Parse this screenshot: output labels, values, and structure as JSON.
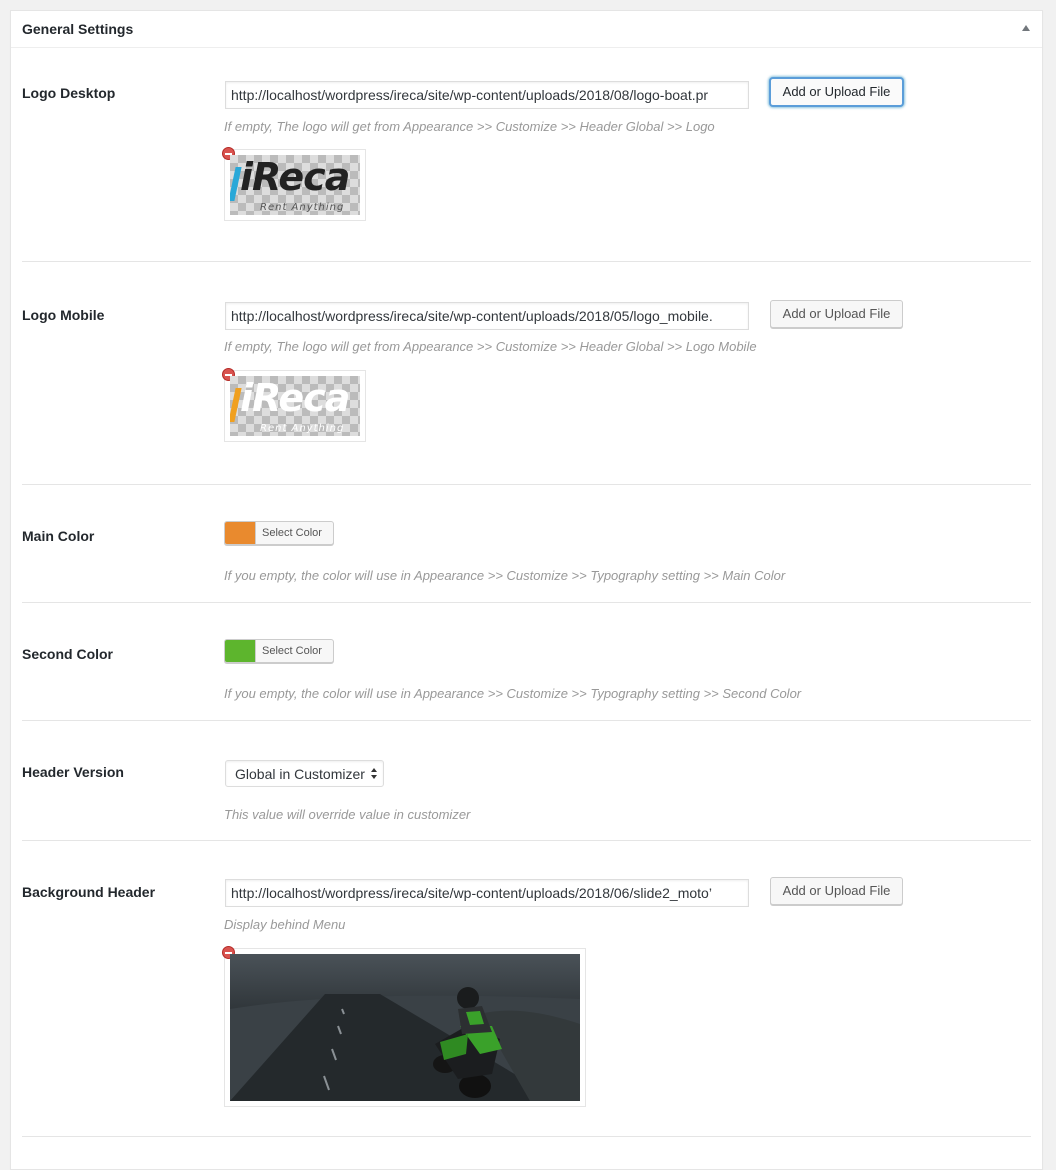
{
  "panel": {
    "title": "General Settings"
  },
  "logo_desktop": {
    "label": "Logo Desktop",
    "url": "http://localhost/wordpress/ireca/site/wp-content/uploads/2018/08/logo-boat.pr",
    "button": "Add or Upload File",
    "description": "If empty, The logo will get from Appearance >> Customize >> Header Global >> Logo",
    "logo_text": "iReca",
    "logo_sub": "Rent Anything",
    "colors": {
      "bar": "#2aa8d8",
      "word": "#222222",
      "sub": "#555555"
    }
  },
  "logo_mobile": {
    "label": "Logo Mobile",
    "url": "http://localhost/wordpress/ireca/site/wp-content/uploads/2018/05/logo_mobile.",
    "button": "Add or Upload File",
    "description": "If empty, The logo will get from Appearance >> Customize >> Header Global >> Logo Mobile",
    "logo_text": "iReca",
    "logo_sub": "Rent Anything",
    "colors": {
      "bar": "#f0a020",
      "word": "#ffffff",
      "sub": "#ffffff"
    }
  },
  "main_color": {
    "label": "Main Color",
    "button": "Select Color",
    "swatch": "#e98a2e",
    "description": "If you empty, the color will use in Appearance >> Customize >> Typography setting >> Main Color"
  },
  "second_color": {
    "label": "Second Color",
    "button": "Select Color",
    "swatch": "#5db52d",
    "description": "If you empty, the color will use in Appearance >> Customize >> Typography setting >> Second Color"
  },
  "header_version": {
    "label": "Header Version",
    "selected": "Global in Customizer",
    "description": "This value will override value in customizer"
  },
  "background_header": {
    "label": "Background Header",
    "url": "http://localhost/wordpress/ireca/site/wp-content/uploads/2018/06/slide2_moto’",
    "button": "Add or Upload File",
    "description": "Display behind Menu"
  }
}
